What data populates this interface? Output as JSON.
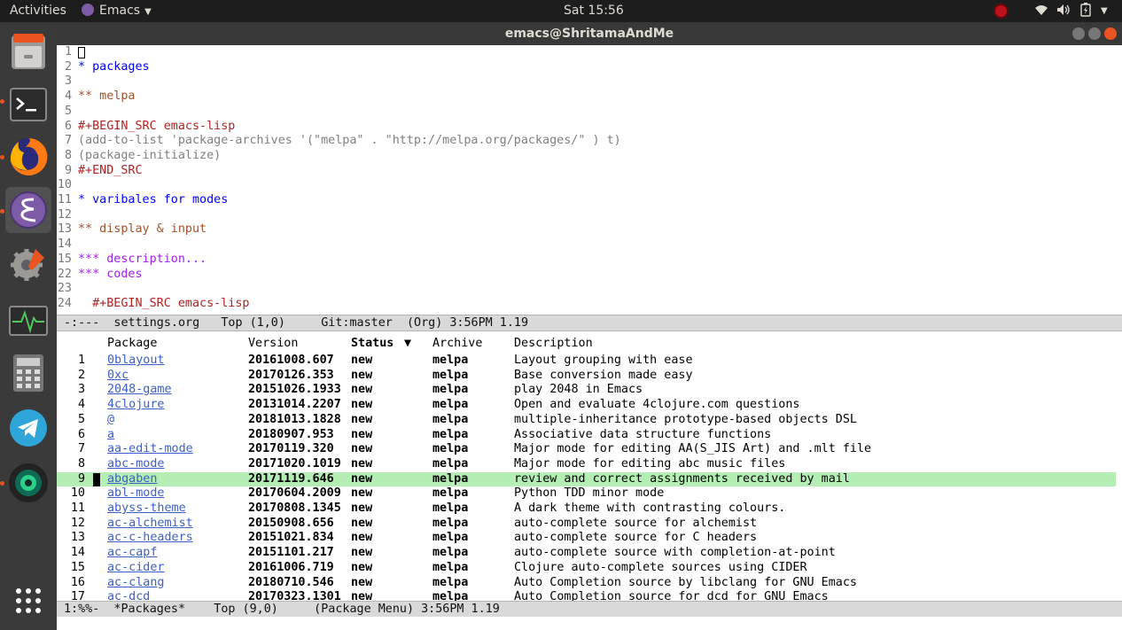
{
  "topbar": {
    "activities": "Activities",
    "app_name": "Emacs",
    "clock": "Sat 15:56"
  },
  "window": {
    "title": "emacs@ShritamaAndMe"
  },
  "org_buffer": {
    "lines": [
      {
        "num": "1",
        "text": "",
        "style": "plain"
      },
      {
        "num": "2",
        "text": "* packages",
        "style": "h1"
      },
      {
        "num": "3",
        "text": "",
        "style": "plain"
      },
      {
        "num": "4",
        "text": "** melpa",
        "style": "h2"
      },
      {
        "num": "5",
        "text": "",
        "style": "plain"
      },
      {
        "num": "6",
        "text": "#+BEGIN_SRC emacs-lisp",
        "style": "kw"
      },
      {
        "num": "7",
        "text": "(add-to-list 'package-archives '(\"melpa\" . \"http://melpa.org/packages/\" ) t)",
        "style": "code"
      },
      {
        "num": "8",
        "text": "(package-initialize)",
        "style": "code"
      },
      {
        "num": "9",
        "text": "#+END_SRC",
        "style": "kw"
      },
      {
        "num": "10",
        "text": "",
        "style": "plain"
      },
      {
        "num": "11",
        "text": "* varibales for modes",
        "style": "h1"
      },
      {
        "num": "12",
        "text": "",
        "style": "plain"
      },
      {
        "num": "13",
        "text": "** display & input",
        "style": "h2"
      },
      {
        "num": "14",
        "text": "",
        "style": "plain"
      },
      {
        "num": "15",
        "text": "*** description...",
        "style": "h3"
      },
      {
        "num": "22",
        "text": "*** codes",
        "style": "h3"
      },
      {
        "num": "23",
        "text": "",
        "style": "plain"
      },
      {
        "num": "24",
        "text": "  #+BEGIN_SRC emacs-lisp",
        "style": "kw"
      }
    ]
  },
  "modeline_top": {
    "text": "-:---  settings.org   Top (1,0)     Git:master  (Org) 3:56PM 1.19"
  },
  "package_menu": {
    "headers": {
      "package": "Package",
      "version": "Version",
      "status": "Status",
      "sort_indicator": "▼",
      "archive": "Archive",
      "description": "Description"
    },
    "rows": [
      {
        "num": "1",
        "name": "0blayout",
        "version": "20161008.607",
        "status": "new",
        "archive": "melpa",
        "desc": "Layout grouping with ease"
      },
      {
        "num": "2",
        "name": "0xc",
        "version": "20170126.353",
        "status": "new",
        "archive": "melpa",
        "desc": "Base conversion made easy"
      },
      {
        "num": "3",
        "name": "2048-game",
        "version": "20151026.1933",
        "status": "new",
        "archive": "melpa",
        "desc": "play 2048 in Emacs"
      },
      {
        "num": "4",
        "name": "4clojure",
        "version": "20131014.2207",
        "status": "new",
        "archive": "melpa",
        "desc": "Open and evaluate 4clojure.com questions"
      },
      {
        "num": "5",
        "name": "@",
        "version": "20181013.1828",
        "status": "new",
        "archive": "melpa",
        "desc": "multiple-inheritance prototype-based objects DSL"
      },
      {
        "num": "6",
        "name": "a",
        "version": "20180907.953",
        "status": "new",
        "archive": "melpa",
        "desc": "Associative data structure functions"
      },
      {
        "num": "7",
        "name": "aa-edit-mode",
        "version": "20170119.320",
        "status": "new",
        "archive": "melpa",
        "desc": "Major mode for editing AA(S_JIS Art) and .mlt file"
      },
      {
        "num": "8",
        "name": "abc-mode",
        "version": "20171020.1019",
        "status": "new",
        "archive": "melpa",
        "desc": "Major mode for editing abc music files"
      },
      {
        "num": "9",
        "name": "abgaben",
        "version": "20171119.646",
        "status": "new",
        "archive": "melpa",
        "desc": "review and correct assignments received by mail",
        "selected": true
      },
      {
        "num": "10",
        "name": "abl-mode",
        "version": "20170604.2009",
        "status": "new",
        "archive": "melpa",
        "desc": "Python TDD minor mode"
      },
      {
        "num": "11",
        "name": "abyss-theme",
        "version": "20170808.1345",
        "status": "new",
        "archive": "melpa",
        "desc": "A dark theme with contrasting colours."
      },
      {
        "num": "12",
        "name": "ac-alchemist",
        "version": "20150908.656",
        "status": "new",
        "archive": "melpa",
        "desc": "auto-complete source for alchemist"
      },
      {
        "num": "13",
        "name": "ac-c-headers",
        "version": "20151021.834",
        "status": "new",
        "archive": "melpa",
        "desc": "auto-complete source for C headers"
      },
      {
        "num": "14",
        "name": "ac-capf",
        "version": "20151101.217",
        "status": "new",
        "archive": "melpa",
        "desc": "auto-complete source with completion-at-point"
      },
      {
        "num": "15",
        "name": "ac-cider",
        "version": "20161006.719",
        "status": "new",
        "archive": "melpa",
        "desc": "Clojure auto-complete sources using CIDER"
      },
      {
        "num": "16",
        "name": "ac-clang",
        "version": "20180710.546",
        "status": "new",
        "archive": "melpa",
        "desc": "Auto Completion source by libclang for GNU Emacs"
      },
      {
        "num": "17",
        "name": "ac-dcd",
        "version": "20170323.1301",
        "status": "new",
        "archive": "melpa",
        "desc": "Auto Completion source for dcd for GNU Emacs"
      }
    ]
  },
  "modeline_bottom": {
    "text": "1:%%-  *Packages*    Top (9,0)     (Package Menu) 3:56PM 1.19"
  },
  "colors": {
    "selected_row": "#b4eeb4",
    "link": "#3a5fcd",
    "org_heading_1": "#0000ff",
    "org_heading_2": "#a0522d",
    "org_heading_3": "#a020f0",
    "org_keyword": "#b22222"
  },
  "dock_icons": [
    "files-icon",
    "terminal-icon",
    "firefox-icon",
    "emacs-icon",
    "settings-icon",
    "system-monitor-icon",
    "calculator-icon",
    "telegram-icon",
    "camera-icon",
    "app-grid-icon"
  ]
}
